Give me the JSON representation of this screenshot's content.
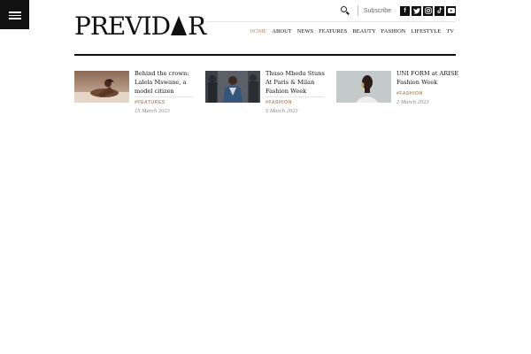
{
  "header": {
    "logo": "PREVIDAR",
    "subscribe_label": "Subscribe",
    "social": [
      "f",
      "t",
      "ig",
      "tk",
      "yt"
    ]
  },
  "nav": {
    "items": [
      "HOME",
      "ABOUT",
      "NEWS",
      "FEATURES",
      "BEAUTY",
      "FASHION",
      "LIFESTYLE",
      "TV"
    ],
    "active": "HOME"
  },
  "articles": [
    {
      "title": "Behind the crown: Lalela Mswane, a model citizen",
      "category": "#FEATURES",
      "date": "15 March 2023"
    },
    {
      "title": "Thuso Mbedu Stuns At Paris & Milan Fashion Week",
      "category": "#FASHION",
      "date": "5 March 2023"
    },
    {
      "title": "UNI FORM at ARISE Fashion Week",
      "category": "#FASHION",
      "date": "2 March 2023"
    }
  ],
  "colors": {
    "accent": "#b8936a",
    "text": "#111111",
    "muted": "#888888"
  }
}
